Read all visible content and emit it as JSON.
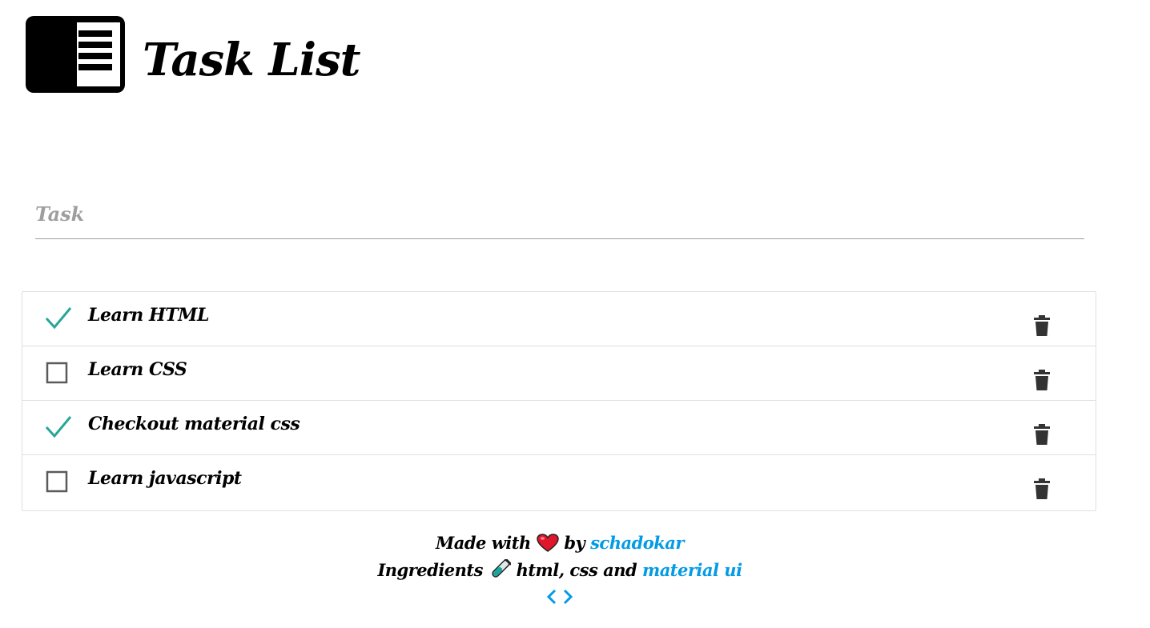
{
  "header": {
    "title": "Task List",
    "logo_icon": "notes-icon"
  },
  "input": {
    "placeholder": "Task",
    "value": ""
  },
  "tasks": [
    {
      "label": "Learn HTML",
      "done": true
    },
    {
      "label": "Learn CSS",
      "done": false
    },
    {
      "label": "Checkout material css",
      "done": true
    },
    {
      "label": "Learn javascript",
      "done": false
    }
  ],
  "footer": {
    "line1_prefix": "Made with",
    "line1_by": "by",
    "author_link": "schadokar",
    "line2_prefix": "Ingredients",
    "line2_middle": "html, css and",
    "framework_link": "material ui",
    "code_icon": "code-icon"
  },
  "colors": {
    "check": "#26a69a",
    "link": "#039be5",
    "trash": "#333333",
    "divider": "#e0e0e0"
  }
}
